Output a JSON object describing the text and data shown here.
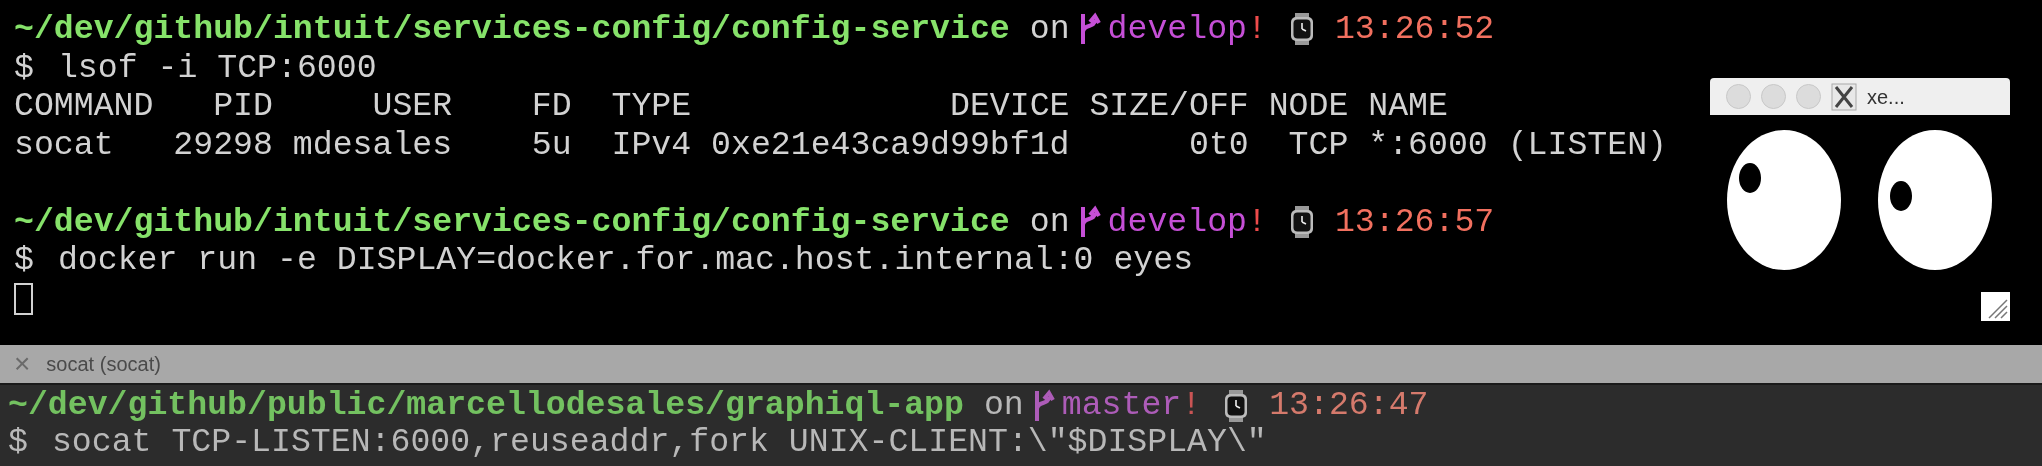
{
  "top_pane": {
    "active": true,
    "lines": [
      {
        "kind": "prompt",
        "path": "~/dev/github/intuit/services-config/config-service",
        "on": "on",
        "branch": "develop",
        "dirty": "!",
        "time": "13:26:52"
      },
      {
        "kind": "command",
        "prompt": "$",
        "text": "lsof -i TCP:6000"
      },
      {
        "kind": "output",
        "text": "COMMAND   PID     USER    FD  TYPE             DEVICE SIZE/OFF NODE NAME"
      },
      {
        "kind": "output",
        "text": "socat   29298 mdesales    5u  IPv4 0xe21e43ca9d99bf1d      0t0  TCP *:6000 (LISTEN)"
      },
      {
        "kind": "blank"
      },
      {
        "kind": "prompt",
        "path": "~/dev/github/intuit/services-config/config-service",
        "on": "on",
        "branch": "develop",
        "dirty": "!",
        "time": "13:26:57"
      },
      {
        "kind": "command",
        "prompt": "$",
        "text": "docker run -e DISPLAY=docker.for.mac.host.internal:0 eyes"
      },
      {
        "kind": "cursor"
      }
    ]
  },
  "tab_bar": {
    "close": "×",
    "title": "socat (socat)"
  },
  "bottom_pane": {
    "active": false,
    "lines": [
      {
        "kind": "prompt",
        "path": "~/dev/github/public/marcellodesales/graphiql-app",
        "on": "on",
        "branch": "master",
        "dirty": "!",
        "time": "13:26:47"
      },
      {
        "kind": "command",
        "prompt": "$",
        "text": "socat TCP-LISTEN:6000,reuseaddr,fork UNIX-CLIENT:\\\"$DISPLAY\\\""
      }
    ]
  },
  "eyes_window": {
    "title": "xe..."
  }
}
